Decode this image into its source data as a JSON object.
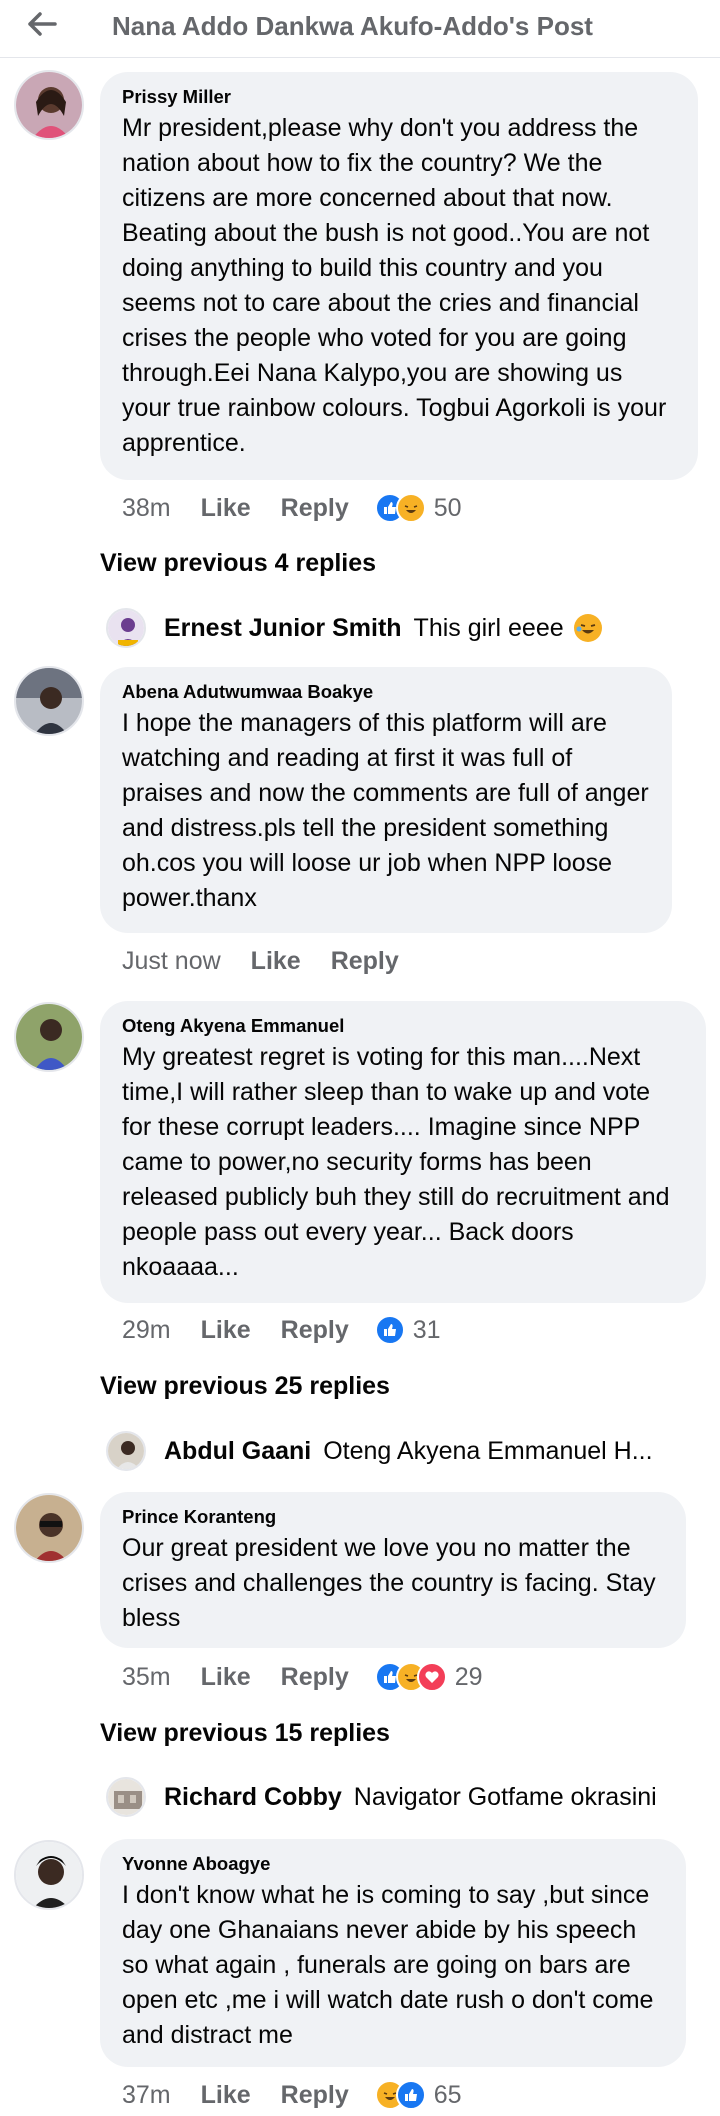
{
  "header": {
    "title": "Nana Addo Dankwa Akufo-Addo's Post"
  },
  "comments": [
    {
      "author": "Prissy Miller",
      "text": "Mr president,please why don't you address the nation about how to fix the country? We the citizens are more concerned about that now. Beating about the bush is not good..You are not doing anything to build this country and you seems not to care about the cries and financial crises the people who voted for you are going through.Eei Nana Kalypo,you are showing us your true rainbow colours. Togbui Agorkoli is your apprentice.",
      "time": "38m",
      "like_label": "Like",
      "reply_label": "Reply",
      "reactions": "50",
      "view_previous": "View previous 4 replies",
      "reply": {
        "author": "Ernest Junior Smith",
        "text": "This girl eeee"
      }
    },
    {
      "author": "Abena Adutwumwaa Boakye",
      "text": "I hope the managers of this platform will are watching and reading at first it was full of praises and now the comments are full of anger and distress.pls tell the president something oh.cos you will loose ur job when NPP loose power.thanx",
      "time": "Just now",
      "like_label": "Like",
      "reply_label": "Reply"
    },
    {
      "author": "Oteng Akyena Emmanuel",
      "text": "My greatest regret is voting for this man....Next time,I will rather sleep than to wake up and vote for these corrupt leaders.... Imagine since NPP came to power,no security forms has been released publicly buh they still do recruitment and people pass out every year... Back doors nkoaaaa...",
      "time": "29m",
      "like_label": "Like",
      "reply_label": "Reply",
      "reactions": "31",
      "view_previous": "View previous 25 replies",
      "reply": {
        "author": "Abdul Gaani",
        "text": "Oteng Akyena Emmanuel H..."
      }
    },
    {
      "author": "Prince Koranteng",
      "text": "Our great president we love you no matter the crises and challenges the country is facing. Stay bless",
      "time": "35m",
      "like_label": "Like",
      "reply_label": "Reply",
      "reactions": "29",
      "view_previous": "View previous 15 replies",
      "reply": {
        "author": "Richard Cobby",
        "text": "Navigator Gotfame okrasini"
      }
    },
    {
      "author": "Yvonne Aboagye",
      "text": "I don't know what he is coming to say ,but since day  one Ghanaians never abide by his speech so what again , funerals are going on bars are open etc  ,me i will watch date rush o don't come and distract me",
      "time": "37m",
      "like_label": "Like",
      "reply_label": "Reply",
      "reactions": "65"
    }
  ],
  "colors": {
    "bubble": "#f0f2f5",
    "meta": "#65676b",
    "like": "#1877f2",
    "haha": "#f7b125",
    "love": "#f33e58"
  }
}
